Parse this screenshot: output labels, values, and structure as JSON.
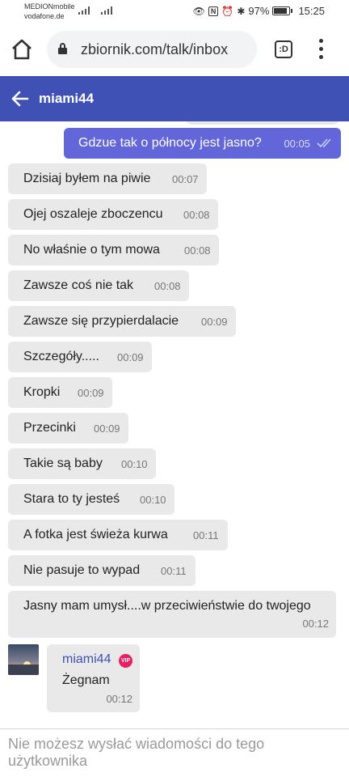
{
  "status_bar": {
    "carrier_1": "MEDIONmobile",
    "carrier_2": "vodafone.de",
    "battery_percent": "97%",
    "time": "15:25",
    "battery_level": 0.97
  },
  "browser": {
    "url": "zbiornik.com/talk/inbox",
    "tabs_icon_label": ":D"
  },
  "header": {
    "title": "miami44",
    "background": "#3f51b5"
  },
  "chat": {
    "outgoing": {
      "text": "Gdzue tak o północy jest jasno?",
      "time": "00:05",
      "bubble_color": "#6366d9"
    },
    "incoming": [
      {
        "text": "Dzisiaj byłem na piwie",
        "time": "00:07"
      },
      {
        "text": "Ojej oszaleje zboczencu",
        "time": "00:08"
      },
      {
        "text": "No właśnie o tym mowa",
        "time": "00:08"
      },
      {
        "text": "Zawsze coś nie tak",
        "time": "00:08"
      },
      {
        "text": "Zawsze się przypierdalacie",
        "time": "00:09"
      },
      {
        "text": "Szczegóły.....",
        "time": "00:09"
      },
      {
        "text": "Kropki",
        "time": "00:09"
      },
      {
        "text": "Przecinki",
        "time": "00:09"
      },
      {
        "text": "Takie są baby",
        "time": "00:10"
      },
      {
        "text": "Stara to ty jesteś",
        "time": "00:10"
      },
      {
        "text": "A fotka jest świeża kurwa",
        "time": "00:11"
      },
      {
        "text": "Nie pasuje to wypad",
        "time": "00:11"
      },
      {
        "text": "Jasny mam umysł....w przeciwieństwie do twojego",
        "time": "00:12"
      }
    ],
    "vip_message": {
      "author": "miami44",
      "badge": "VIP",
      "text": "Żegnam",
      "time": "00:12"
    }
  },
  "footer": {
    "notice": "Nie możesz wysłać wiadomości do tego użytkownika"
  }
}
